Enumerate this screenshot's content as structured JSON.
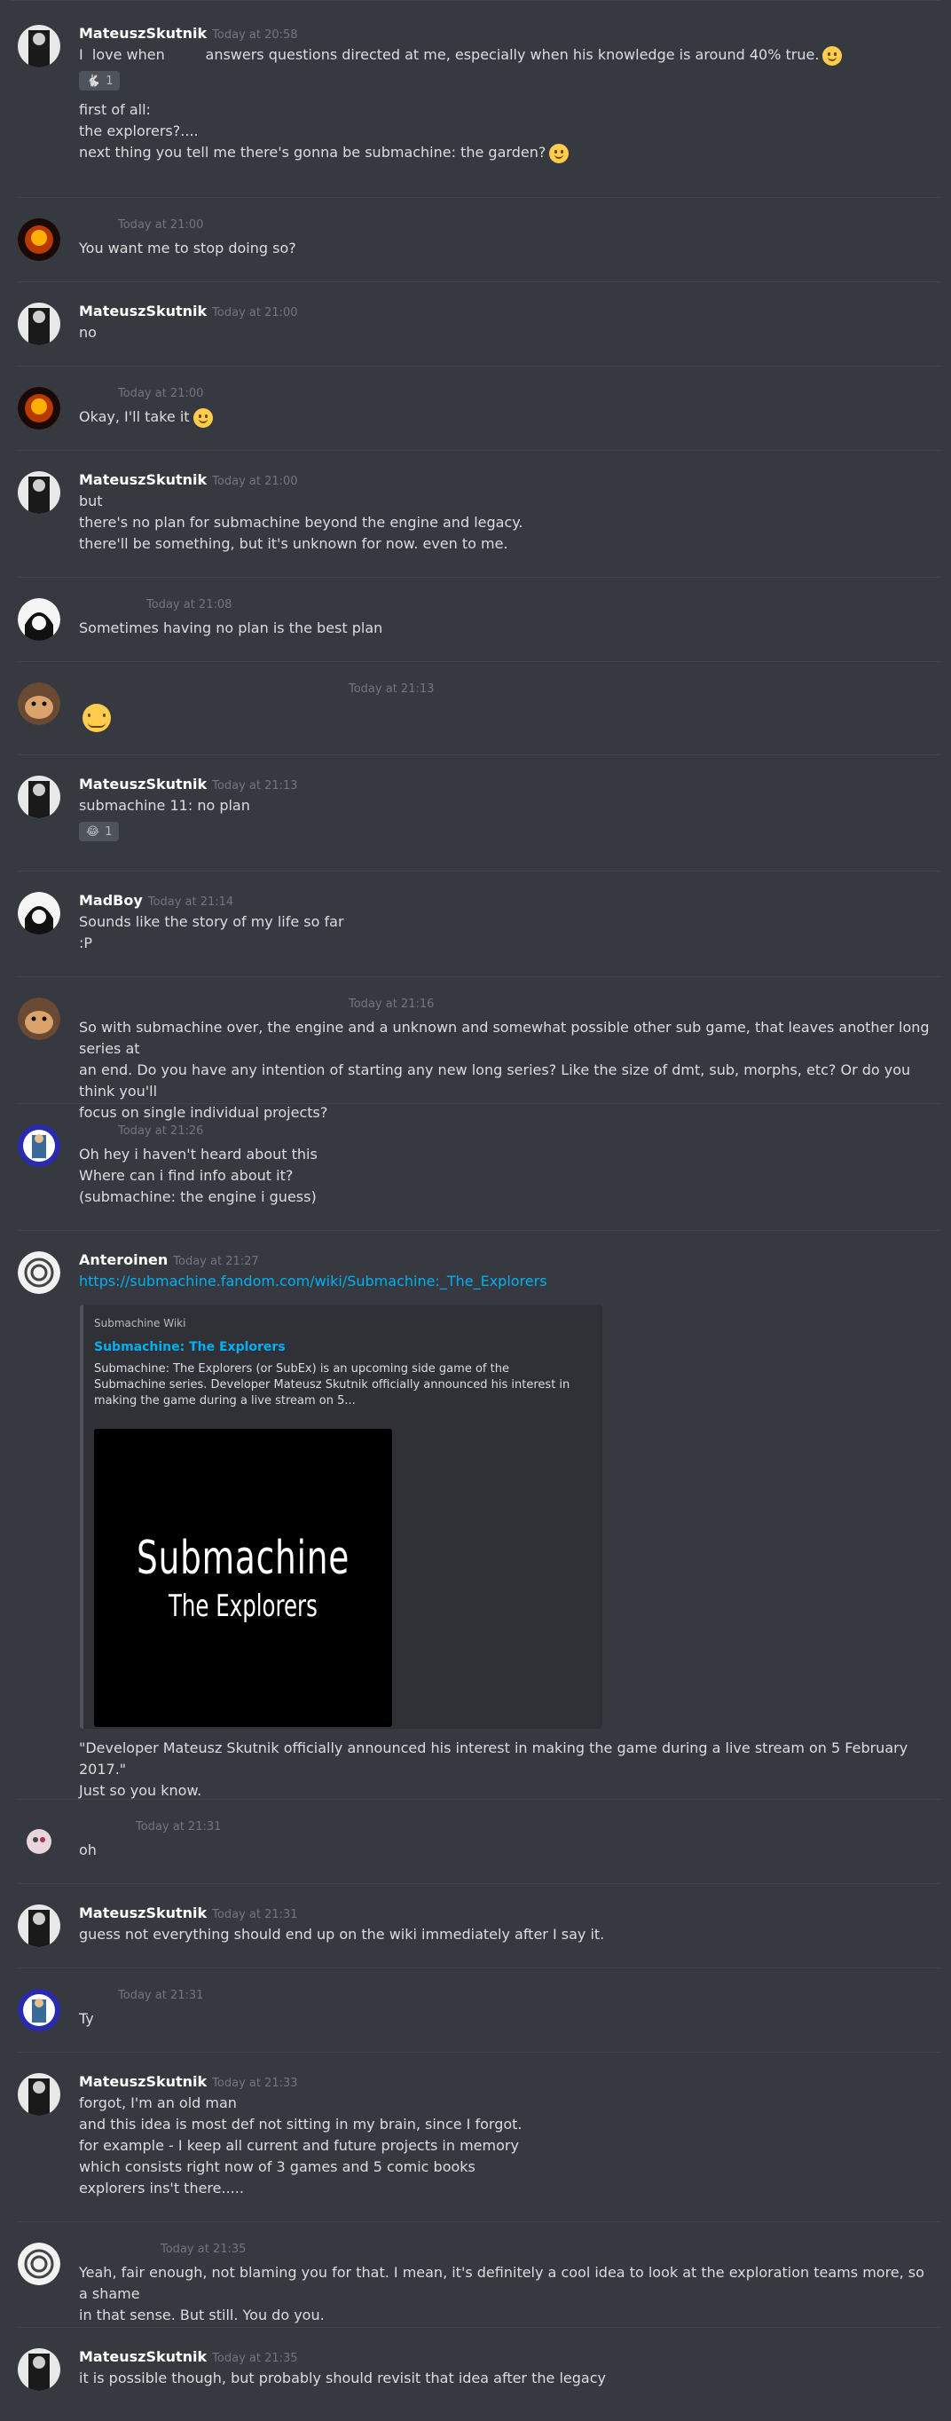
{
  "messages": [
    {
      "author": "MateuszSkutnik",
      "time": "Today at 20:58",
      "avatar_color": "#222222",
      "lines": [
        "I  love when         answers questions directed at me, especially when his knowledge is around 40% true."
      ],
      "reaction_count": "1",
      "extra_lines": [
        "first of all:",
        "the explorers?....",
        "next thing you tell me there's gonna be submachine: the garden?"
      ]
    },
    {
      "author": "",
      "time": "Today at 21:00",
      "avatar_color": "#8b1a00",
      "lines": [
        "You want me to stop doing so?"
      ]
    },
    {
      "author": "MateuszSkutnik",
      "time": "Today at 21:00",
      "avatar_color": "#222222",
      "lines": [
        "no"
      ]
    },
    {
      "author": "",
      "time": "Today at 21:00",
      "avatar_color": "#8b1a00",
      "lines": [
        "Okay, I'll take it"
      ]
    },
    {
      "author": "MateuszSkutnik",
      "time": "Today at 21:00",
      "avatar_color": "#222222",
      "lines": [
        "but",
        "there's no plan for submachine beyond the engine and legacy.",
        "there'll be something, but it's unknown for now. even to me."
      ]
    },
    {
      "author": "",
      "time": "Today at 21:08",
      "avatar_color": "#eeeeee",
      "lines": [
        "Sometimes having no plan is the best plan"
      ]
    },
    {
      "author": "",
      "time": "Today at 21:13",
      "avatar_color": "#8a5a3a",
      "lines": []
    },
    {
      "author": "MateuszSkutnik",
      "time": "Today at 21:13",
      "avatar_color": "#222222",
      "lines": [
        "submachine 11: no plan"
      ],
      "reaction_count": "1"
    },
    {
      "author": "MadBoy",
      "time": "Today at 21:14",
      "avatar_color": "#eeeeee",
      "lines": [
        "Sounds like the story of my life so far",
        ":P"
      ]
    },
    {
      "author": "",
      "time": "Today at 21:16",
      "avatar_color": "#8a5a3a",
      "lines": [
        "So with submachine over, the engine and a unknown and somewhat possible other sub game, that leaves another long series at",
        "an end. Do you have any intention of starting any new long series? Like the size of dmt, sub, morphs, etc? Or do you think you'll",
        "focus on single individual projects?"
      ]
    },
    {
      "author": "",
      "time": "Today at 21:26",
      "avatar_color": "#2a2aa0",
      "lines": [
        "Oh hey i haven't heard about this",
        "Where can i find info about it?",
        "(submachine: the engine i guess)"
      ]
    },
    {
      "author": "Anteroinen",
      "time": "Today at 21:27",
      "avatar_color": "#f2f2f2",
      "link": "https://submachine.fandom.com/wiki/Submachine:_The_Explorers",
      "after_embed": [
        "\"Developer Mateusz Skutnik officially announced his interest in making the game during a live stream on 5 February 2017.\"",
        "Just so you know."
      ]
    },
    {
      "author": "",
      "time": "Today at 21:31",
      "avatar_color": "#d9c9d0",
      "lines": [
        "oh"
      ]
    },
    {
      "author": "MateuszSkutnik",
      "time": "Today at 21:31",
      "avatar_color": "#222222",
      "lines": [
        "guess not everything should end up on the wiki immediately after I say it."
      ]
    },
    {
      "author": "",
      "time": "Today at 21:31",
      "avatar_color": "#2a2aa0",
      "lines": [
        "Ty"
      ]
    },
    {
      "author": "MateuszSkutnik",
      "time": "Today at 21:33",
      "avatar_color": "#222222",
      "lines": [
        "forgot, I'm an old man",
        "and this idea is most def not sitting in my brain, since I forgot.",
        "for example - I keep all current and future projects in memory",
        "which consists right now of 3 games and 5 comic books",
        "explorers ins't there....."
      ]
    },
    {
      "author": "",
      "time": "Today at 21:35",
      "avatar_color": "#f2f2f2",
      "lines": [
        "Yeah, fair enough, not blaming you for that. I mean, it's definitely a cool idea to look at the exploration teams more, so a shame",
        "in that sense. But still. You do you."
      ]
    },
    {
      "author": "MateuszSkutnik",
      "time": "Today at 21:35",
      "avatar_color": "#222222",
      "lines": [
        "it is possible though, but probably should revisit that idea after the legacy"
      ]
    }
  ],
  "embed": {
    "provider": "Submachine Wiki",
    "title": "Submachine: The Explorers",
    "description": "Submachine: The Explorers (or SubEx) is an upcoming side game of the Submachine series. Developer Mateusz Skutnik officially announced his interest in making the game during a live stream on 5...",
    "image_title": "Submachine",
    "image_subtitle": "The Explorers"
  }
}
